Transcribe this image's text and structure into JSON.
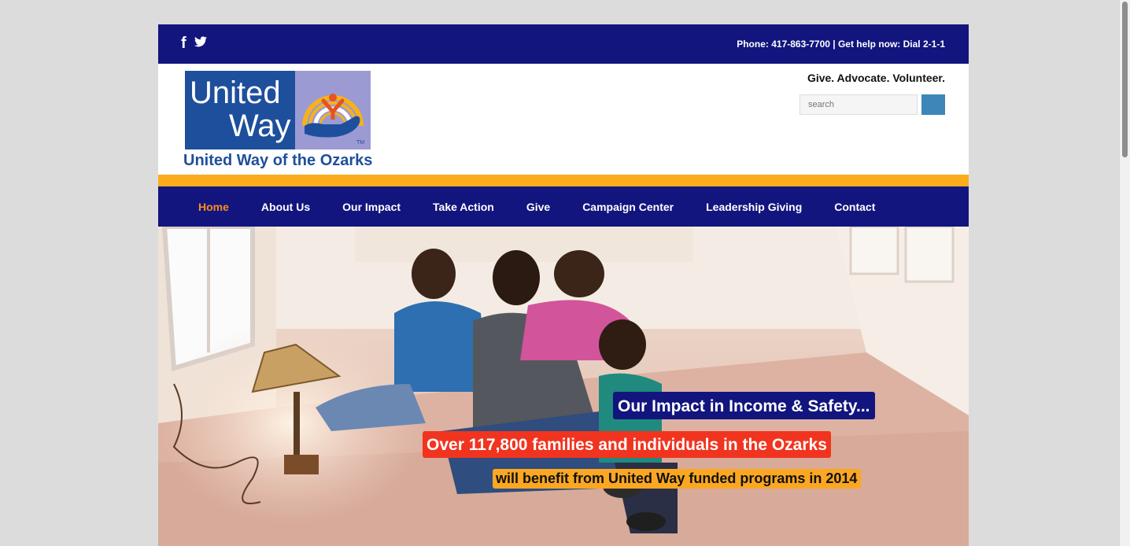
{
  "topbar": {
    "social": {
      "facebook_icon": "facebook-icon",
      "twitter_icon": "twitter-icon"
    },
    "info": "Phone: 417-863-7700 |  Get help now: Dial 2-1-1"
  },
  "header": {
    "logo_word1": "United",
    "logo_word2": "Way",
    "logo_tm": "TM",
    "logo_subtitle": "United Way of the Ozarks",
    "tagline": "Give. Advocate. Volunteer.",
    "search": {
      "placeholder": "search"
    }
  },
  "colors": {
    "navy": "#12157e",
    "orange": "#fbab1b",
    "active_nav": "#fb8c1e",
    "logo_blue": "#1e4f9c",
    "logo_lavender": "#9c9ad3",
    "red": "#f1341f",
    "search_button": "#3c87b7"
  },
  "nav": {
    "items": [
      {
        "label": "Home",
        "active": true
      },
      {
        "label": "About Us"
      },
      {
        "label": "Our Impact"
      },
      {
        "label": "Take Action"
      },
      {
        "label": "Give"
      },
      {
        "label": "Campaign Center"
      },
      {
        "label": "Leadership Giving"
      },
      {
        "label": "Contact"
      }
    ]
  },
  "hero": {
    "line1": "Our Impact in Income & Safety...",
    "line2": "Over 117,800 families and individuals in the Ozarks",
    "line3": "will benefit from United Way funded programs in 2014"
  }
}
